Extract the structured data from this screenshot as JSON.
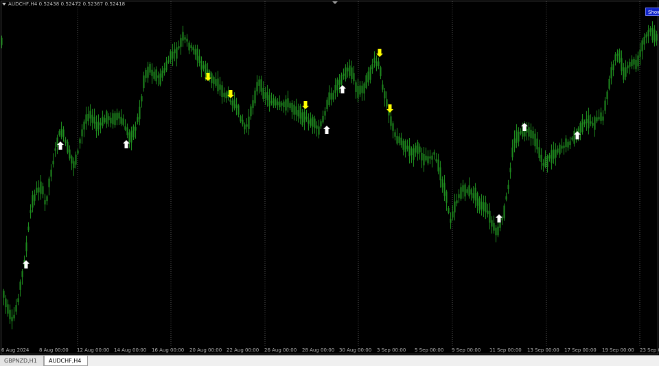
{
  "chart_header": {
    "symbol_text": "AUDCHF,H4  0.52438 0.52472 0.52367 0.52418"
  },
  "show_button": {
    "label": "Show"
  },
  "x_axis": {
    "date_labels": [
      "6 Aug 2024",
      "8 Aug 00:00",
      "12 Aug 00:00",
      "14 Aug 00:00",
      "16 Aug 00:00",
      "20 Aug 00:00",
      "22 Aug 00:00",
      "26 Aug 00:00",
      "28 Aug 00:00",
      "30 Aug 00:00",
      "3 Sep 00:00",
      "5 Sep 00:00",
      "9 Sep 00:00",
      "11 Sep 00:00",
      "13 Sep 00:00",
      "17 Sep 00:00",
      "19 Sep 00:00",
      "23 Sep 0"
    ]
  },
  "tabs": [
    {
      "label": "GBPNZD,H1",
      "active": false
    },
    {
      "label": "AUDCHF,H4",
      "active": true
    }
  ],
  "colors": {
    "background": "#000000",
    "candle": "#1f8f1f",
    "arrow_up": "#ffffff",
    "arrow_down": "#ffff00",
    "period_separator": "#3c3c3c"
  },
  "icons": {
    "buy_signal": "arrow-up-icon",
    "sell_signal": "arrow-down-icon"
  }
}
